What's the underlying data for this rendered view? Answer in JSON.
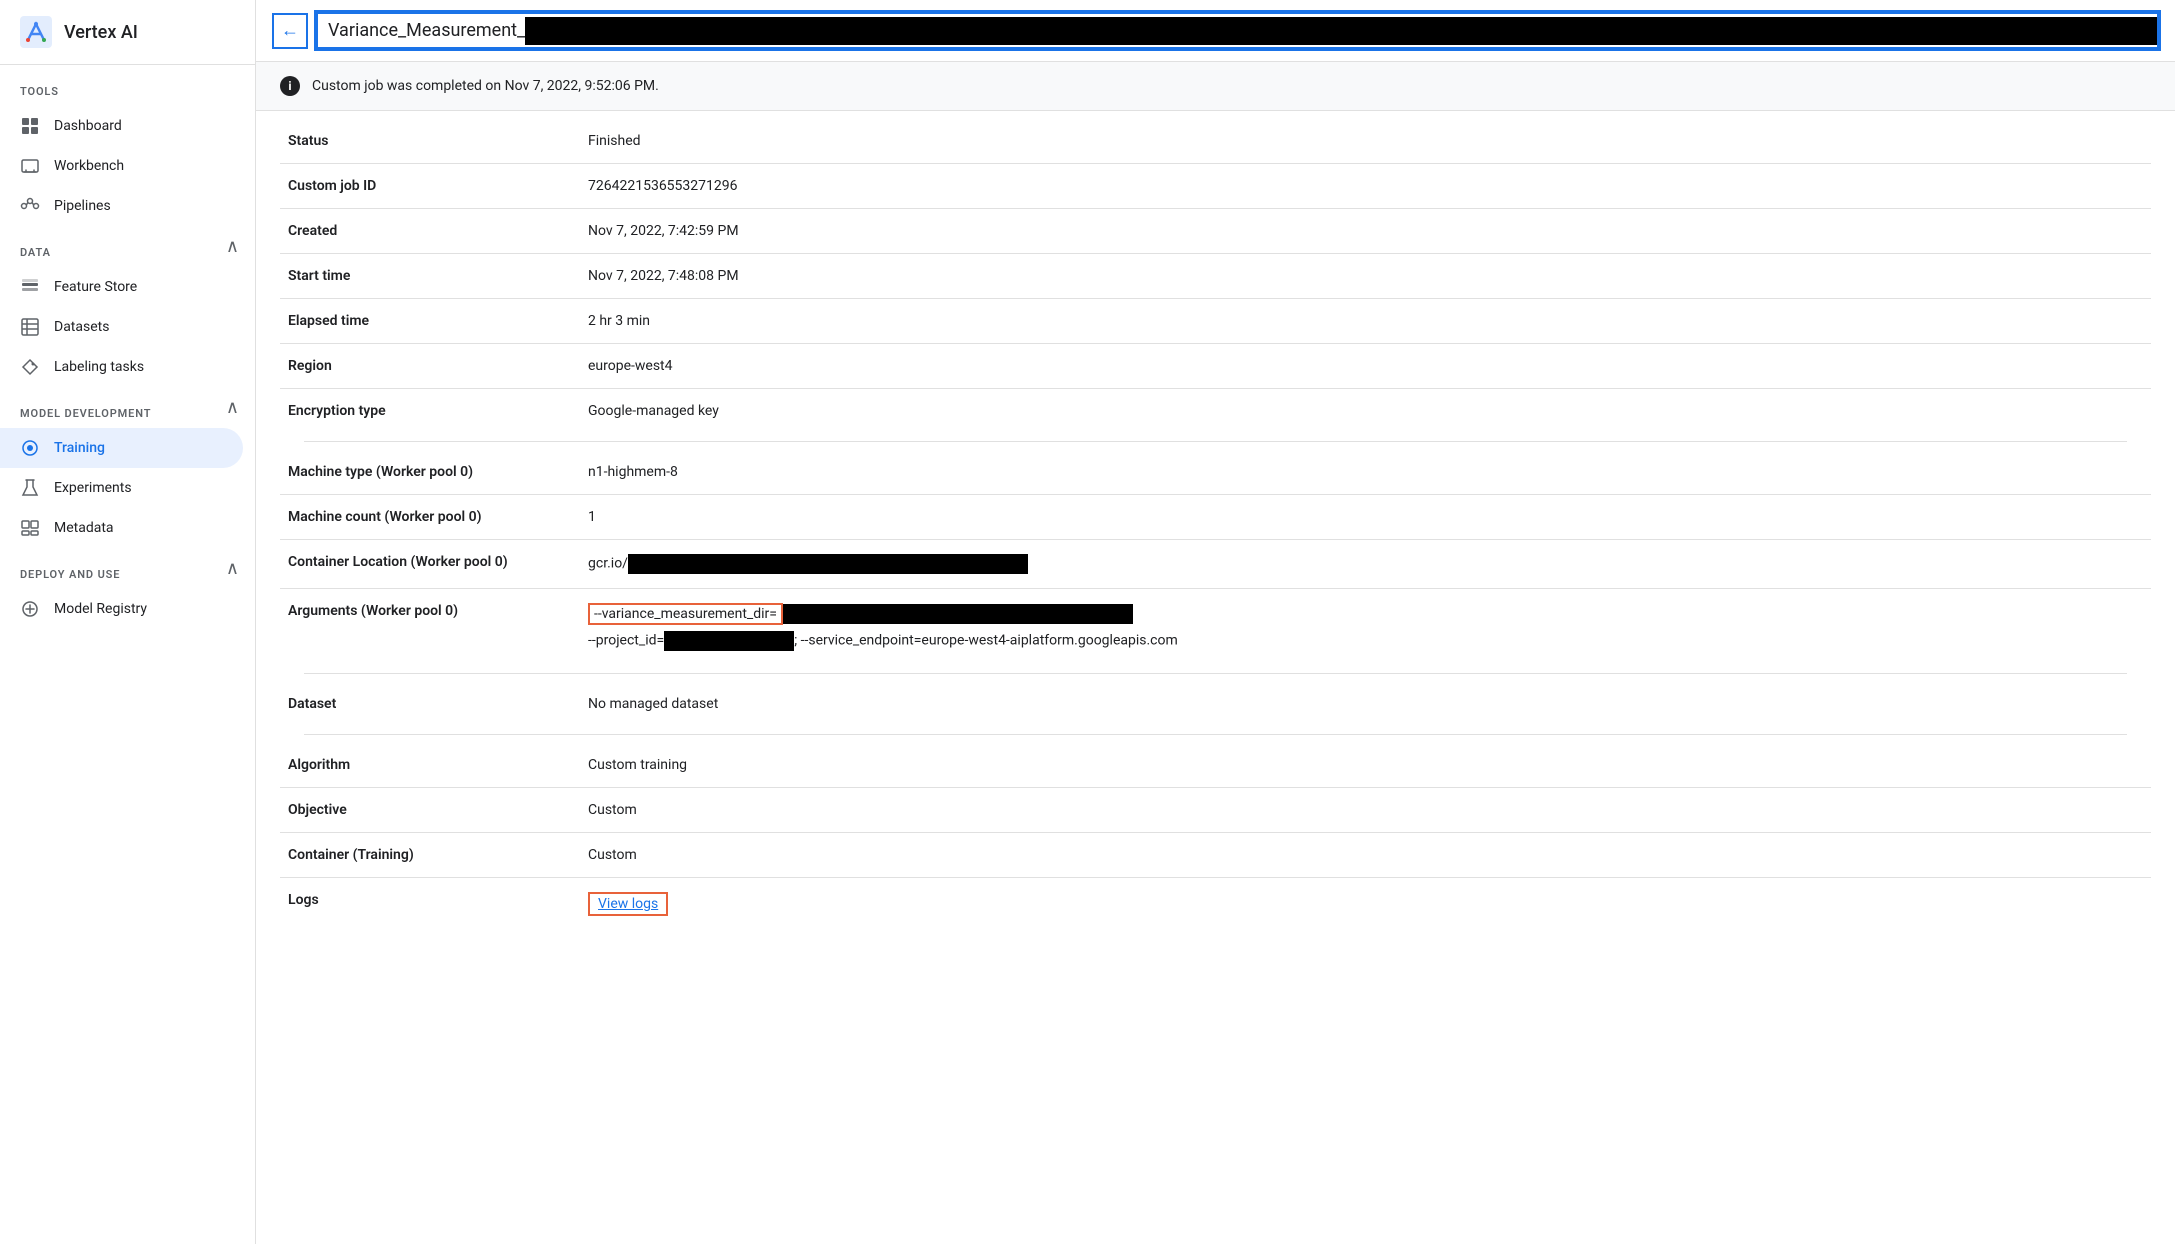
{
  "sidebar": {
    "title": "Vertex AI",
    "sections": [
      {
        "label": "TOOLS",
        "items": [
          {
            "id": "dashboard",
            "label": "Dashboard",
            "icon": "dashboard",
            "active": false
          },
          {
            "id": "workbench",
            "label": "Workbench",
            "icon": "workbench",
            "active": false
          },
          {
            "id": "pipelines",
            "label": "Pipelines",
            "icon": "pipelines",
            "active": false
          }
        ]
      },
      {
        "label": "DATA",
        "collapsible": true,
        "items": [
          {
            "id": "feature-store",
            "label": "Feature Store",
            "icon": "featurestore",
            "active": false
          },
          {
            "id": "datasets",
            "label": "Datasets",
            "icon": "datasets",
            "active": false
          },
          {
            "id": "labeling-tasks",
            "label": "Labeling tasks",
            "icon": "labeling",
            "active": false
          }
        ]
      },
      {
        "label": "MODEL DEVELOPMENT",
        "collapsible": true,
        "items": [
          {
            "id": "training",
            "label": "Training",
            "icon": "training",
            "active": true
          },
          {
            "id": "experiments",
            "label": "Experiments",
            "icon": "experiments",
            "active": false
          },
          {
            "id": "metadata",
            "label": "Metadata",
            "icon": "metadata",
            "active": false
          }
        ]
      },
      {
        "label": "DEPLOY AND USE",
        "collapsible": true,
        "items": [
          {
            "id": "model-registry",
            "label": "Model Registry",
            "icon": "model",
            "active": false
          }
        ]
      }
    ]
  },
  "topbar": {
    "back_button_label": "←",
    "title_visible": "Variance_Measurement_"
  },
  "info_banner": {
    "message": "Custom job was completed on Nov 7, 2022, 9:52:06 PM."
  },
  "details": {
    "groups": [
      {
        "rows": [
          {
            "label": "Status",
            "value": "Finished",
            "type": "text"
          },
          {
            "label": "Custom job ID",
            "value": "7264221536553271296",
            "type": "text"
          },
          {
            "label": "Created",
            "value": "Nov 7, 2022, 7:42:59 PM",
            "type": "text"
          },
          {
            "label": "Start time",
            "value": "Nov 7, 2022, 7:48:08 PM",
            "type": "text"
          },
          {
            "label": "Elapsed time",
            "value": "2 hr 3 min",
            "type": "text"
          },
          {
            "label": "Region",
            "value": "europe-west4",
            "type": "text"
          },
          {
            "label": "Encryption type",
            "value": "Google-managed key",
            "type": "text"
          }
        ]
      },
      {
        "rows": [
          {
            "label": "Machine type (Worker pool 0)",
            "value": "n1-highmem-8",
            "type": "text"
          },
          {
            "label": "Machine count (Worker pool 0)",
            "value": "1",
            "type": "text"
          },
          {
            "label": "Container Location (Worker pool 0)",
            "value": "gcr.io/",
            "type": "container-loc"
          },
          {
            "label": "Arguments (Worker pool 0)",
            "value": "--variance_measurement_dir=",
            "value2": "--project_id=",
            "value3": "; --service_endpoint=europe-west4-aiplatform.googleapis.com",
            "type": "args"
          }
        ]
      },
      {
        "rows": [
          {
            "label": "Dataset",
            "value": "No managed dataset",
            "type": "text"
          }
        ]
      },
      {
        "rows": [
          {
            "label": "Algorithm",
            "value": "Custom training",
            "type": "text"
          },
          {
            "label": "Objective",
            "value": "Custom",
            "type": "text"
          },
          {
            "label": "Container (Training)",
            "value": "Custom",
            "type": "text"
          },
          {
            "label": "Logs",
            "value": "View logs",
            "type": "link"
          }
        ]
      }
    ]
  }
}
